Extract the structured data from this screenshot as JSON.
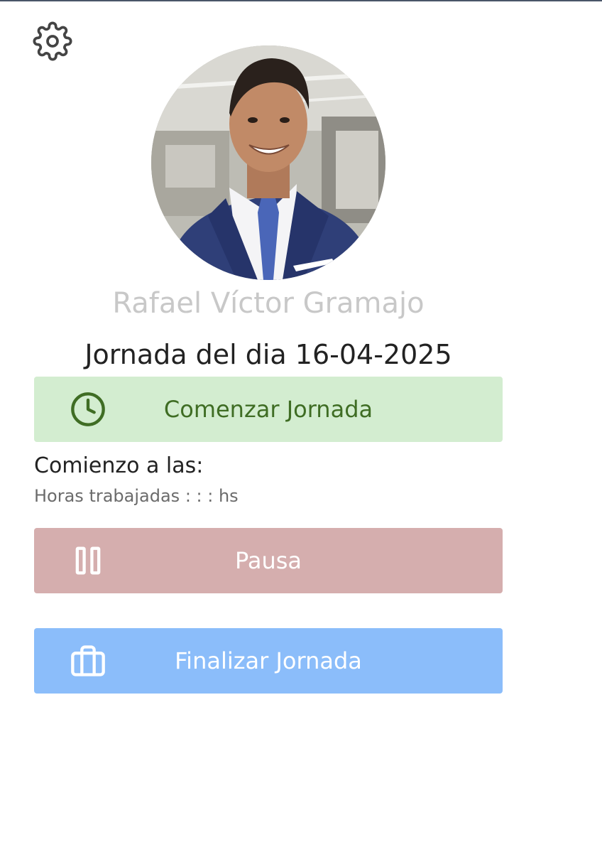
{
  "user": {
    "name": "Rafael Víctor Gramajo",
    "avatar_alt": "profile-photo"
  },
  "workday": {
    "title": "Jornada del dia 16-04-2025",
    "start_label": "Comienzo a las:",
    "hours_label": "Horas trabajadas : : : hs"
  },
  "buttons": {
    "start": {
      "label": "Comenzar Jornada",
      "icon": "clock-icon",
      "color": "#d3edd0",
      "text_color": "#3f6d24"
    },
    "pause": {
      "label": "Pausa",
      "icon": "pause-icon",
      "color": "#d5aeae",
      "text_color": "#ffffff"
    },
    "finish": {
      "label": "Finalizar Jornada",
      "icon": "briefcase-icon",
      "color": "#8bbdfa",
      "text_color": "#ffffff"
    }
  },
  "settings": {
    "icon": "gear-icon"
  }
}
